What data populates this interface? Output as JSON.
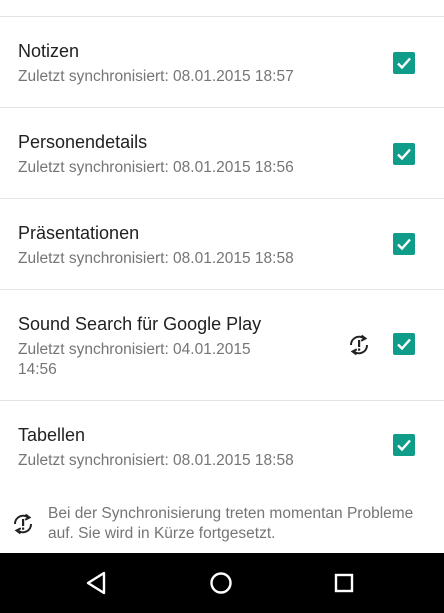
{
  "accounts": [
    {
      "title": "Notizen",
      "status": "Zuletzt synchronisiert: 08.01.2015 18:57",
      "checked": true,
      "error": false
    },
    {
      "title": "Personendetails",
      "status": "Zuletzt synchronisiert: 08.01.2015 18:56",
      "checked": true,
      "error": false
    },
    {
      "title": "Präsentationen",
      "status": "Zuletzt synchronisiert: 08.01.2015 18:58",
      "checked": true,
      "error": false
    },
    {
      "title": "Sound Search für Google Play",
      "status": "Zuletzt synchronisiert: 04.01.2015 14:56",
      "checked": true,
      "error": true
    },
    {
      "title": "Tabellen",
      "status": "Zuletzt synchronisiert: 08.01.2015 18:58",
      "checked": true,
      "error": false
    }
  ],
  "notice": {
    "text": "Bei der Synchronisierung treten momentan Probleme auf. Sie wird in Kürze fortgesetzt."
  },
  "colors": {
    "accent": "#0f9d8a",
    "title": "#212121",
    "secondary": "#757575",
    "divider": "#e3e3e3",
    "navbar": "#000000"
  },
  "navigation": {
    "back_icon": "back-triangle-icon",
    "home_icon": "home-circle-icon",
    "recents_icon": "recents-square-icon"
  }
}
